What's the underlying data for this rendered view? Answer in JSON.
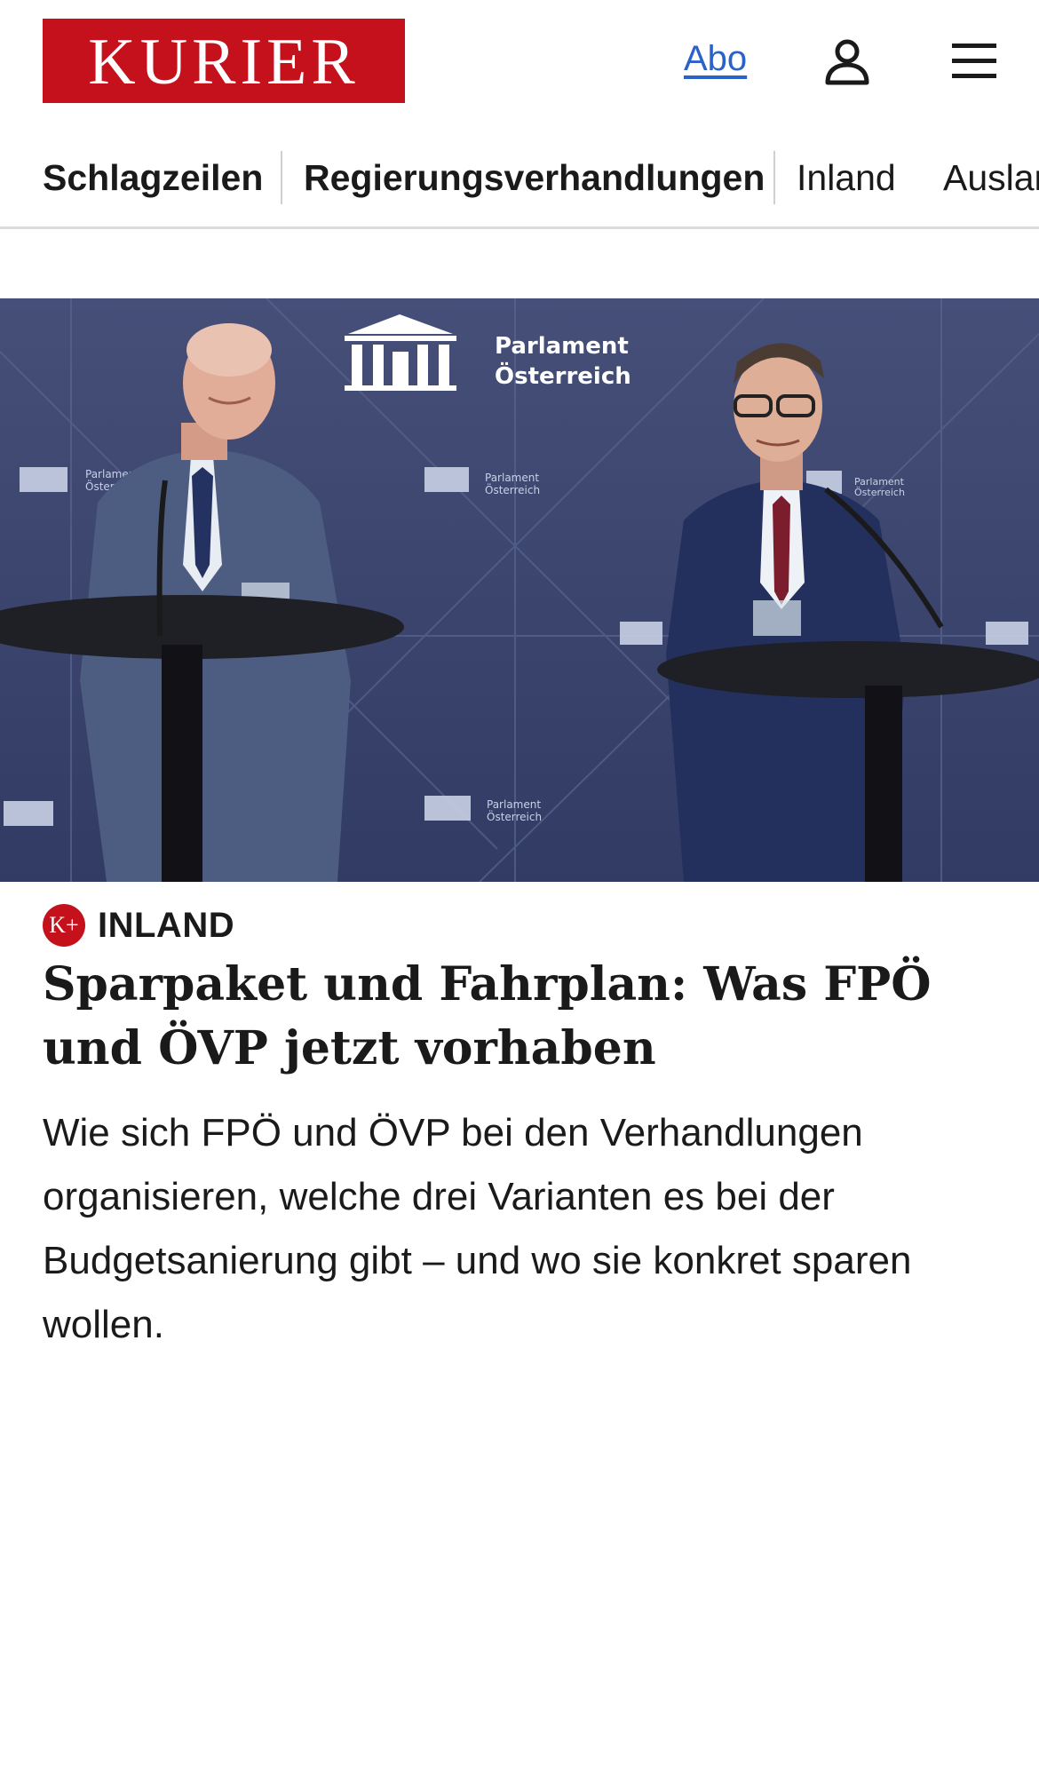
{
  "header": {
    "logo_text": "KURIER",
    "abo_label": "Abo",
    "user_icon": "user-icon",
    "menu_icon": "hamburger-menu-icon"
  },
  "nav": {
    "items": [
      {
        "label": "Schlagzeilen"
      },
      {
        "label": "Regierungsverhandlungen"
      },
      {
        "label": "Inland"
      },
      {
        "label": "Ausland"
      }
    ]
  },
  "hero": {
    "backdrop_text_line1": "Parlament",
    "backdrop_text_line2": "Österreich",
    "small_logo_line1": "Parlament",
    "small_logo_line2": "Österreich"
  },
  "article": {
    "badge_text": "K+",
    "category": "INLAND",
    "headline": "Sparpaket und Fahrplan: Was FPÖ und ÖVP jetzt vorhaben",
    "teaser": "Wie sich FPÖ und ÖVP bei den Verhandlungen organisieren, welche drei Varianten es bei der Budgetsanierung gibt – und wo sie konkret sparen wollen."
  },
  "colors": {
    "brand_red": "#c4111c",
    "link_blue": "#2a62c9",
    "backdrop_blue": "#3c4870"
  }
}
